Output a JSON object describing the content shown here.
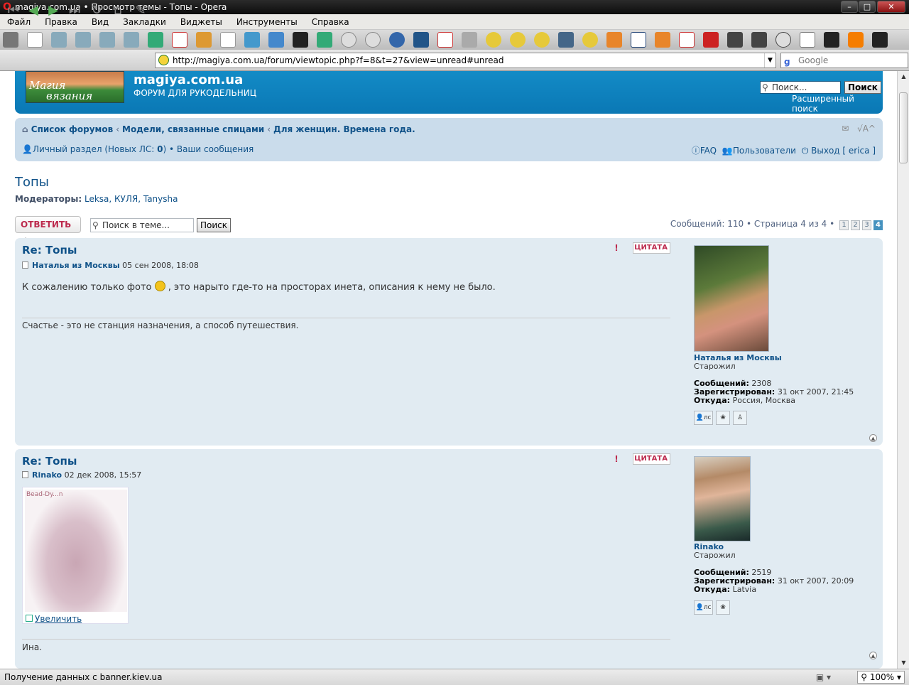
{
  "window": {
    "title": "magiya.com.ua • Просмотр темы - Топы - Opera"
  },
  "menu": [
    "Файл",
    "Правка",
    "Вид",
    "Закладки",
    "Виджеты",
    "Инструменты",
    "Справка"
  ],
  "address": {
    "url": "http://magiya.com.ua/forum/viewtopic.php?f=8&t=27&view=unread#unread"
  },
  "web_search": {
    "placeholder": "Google"
  },
  "site": {
    "logo_line1": "Магия",
    "logo_line2": "вязания",
    "name": "magiya.com.ua",
    "description": "ФОРУМ ДЛЯ РУКОДЕЛЬНИЦ",
    "search_placeholder": "Поиск...",
    "search_button": "Поиск",
    "advanced_search": "Расширенный поиск"
  },
  "breadcrumbs": [
    "Список форумов",
    "Модели, связанные спицами",
    "Для женщин. Времена года."
  ],
  "user_nav": {
    "pm_label": "Личный раздел (Новых ЛС: ",
    "pm_count": "0",
    "pm_close": ")",
    "sep": " • ",
    "your_posts": "Ваши сообщения",
    "faq": "FAQ",
    "members": "Пользователи",
    "logout": "Выход [ erica ]"
  },
  "topic": {
    "title": "Топы",
    "moderators_label": "Модераторы:",
    "moderators": "Leksa, КУЛЯ, Tanysha",
    "reply_button": "ОТВЕТИТЬ",
    "search_placeholder": "Поиск в теме...",
    "search_button": "Поиск",
    "pagination_text": "Сообщений: 110 • Страница 4 из 4 •",
    "pages": [
      "1",
      "2",
      "3",
      "4"
    ]
  },
  "posts": [
    {
      "title": "Re: Топы",
      "author": "Наталья из Москвы",
      "date": "05 сен 2008, 18:08",
      "text_before": "К сожалению только фото",
      "text_after": ", это нарыто где-то на просторах инета, описания к нему не было.",
      "signature": "Счастье - это не станция назначения, а способ путешествия.",
      "quote_label": "ЦИТАТА",
      "profile": {
        "name": "Наталья из Москвы",
        "rank": "Старожил",
        "posts_label": "Сообщений:",
        "posts": "2308",
        "joined_label": "Зарегистрирован:",
        "joined": "31 окт 2007, 21:45",
        "from_label": "Откуда:",
        "from": "Россия, Москва"
      }
    },
    {
      "title": "Re: Топы",
      "author": "Rinako",
      "date": "02 дек 2008, 15:57",
      "attachment_watermark": "Bead-Dy...n",
      "attachment_link": "Увеличить",
      "signature": "Ина.",
      "quote_label": "ЦИТАТА",
      "profile": {
        "name": "Rinako",
        "rank": "Старожил",
        "posts_label": "Сообщений:",
        "posts": "2519",
        "joined_label": "Зарегистрирован:",
        "joined": "31 окт 2007, 20:09",
        "from_label": "Откуда:",
        "from": "Latvia"
      }
    }
  ],
  "status": {
    "text": "Получение данных с banner.kiev.ua",
    "zoom": "100%"
  }
}
